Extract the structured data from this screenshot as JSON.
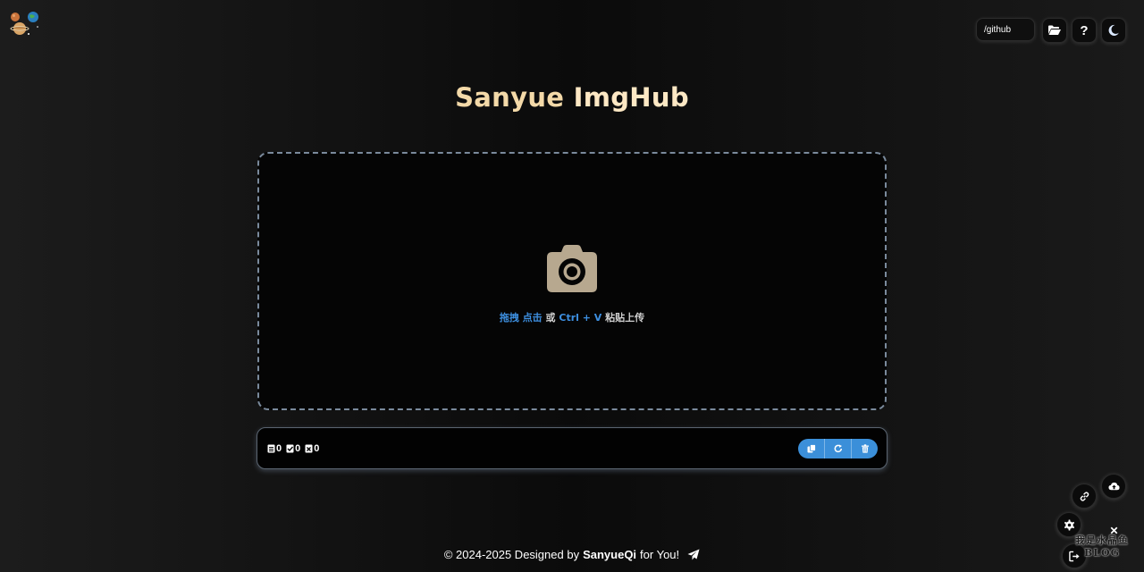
{
  "header": {
    "path_input_value": "/github",
    "buttons": [
      {
        "name": "folder-button",
        "icon": "folder-open-icon"
      },
      {
        "name": "help-button",
        "icon": "question-icon",
        "label": "?"
      },
      {
        "name": "theme-toggle-button",
        "icon": "moon-icon"
      }
    ]
  },
  "title": {
    "part1": "Sanyue",
    "part2": "ImgHub"
  },
  "dropzone": {
    "icon": "camera-icon",
    "hint_drag": "拖拽",
    "hint_click": "点击",
    "hint_or": "或",
    "hint_shortcut": "Ctrl + V",
    "hint_paste": "粘贴上传"
  },
  "status": {
    "counters": [
      {
        "name": "total",
        "icon": "file-icon",
        "value": "0"
      },
      {
        "name": "done",
        "icon": "file-check-icon",
        "value": "0"
      },
      {
        "name": "failed",
        "icon": "file-error-icon",
        "value": "0"
      }
    ],
    "actions": [
      {
        "name": "copy-all-button",
        "icon": "copy-icon"
      },
      {
        "name": "retry-button",
        "icon": "refresh-icon"
      },
      {
        "name": "clear-button",
        "icon": "trash-icon"
      }
    ]
  },
  "watermark": {
    "line1": "我是水晶鱼",
    "line2": "BLOG"
  },
  "footer": {
    "prefix": "© 2024-2025 Designed by",
    "author": "SanyueQi",
    "suffix": "for You!"
  },
  "colors": {
    "accent": "#3b8fd9",
    "title_1": "#f3d9a8",
    "title_2": "#fde8c4",
    "link": "#3d8fe0"
  }
}
